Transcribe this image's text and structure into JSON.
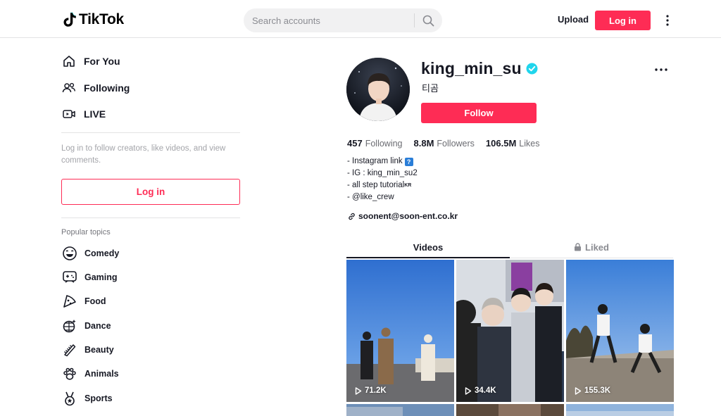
{
  "header": {
    "logo": "TikTok",
    "logo_icon": "tiktok-note-icon",
    "search_placeholder": "Search accounts",
    "upload_label": "Upload",
    "login_label": "Log in"
  },
  "sidebar": {
    "nav": [
      {
        "label": "For You",
        "icon": "home-icon"
      },
      {
        "label": "Following",
        "icon": "people-icon"
      },
      {
        "label": "LIVE",
        "icon": "live-icon"
      }
    ],
    "hint": "Log in to follow creators, like videos, and view comments.",
    "login_label": "Log in",
    "topics_title": "Popular topics",
    "topics": [
      {
        "label": "Comedy",
        "icon": "smile-icon"
      },
      {
        "label": "Gaming",
        "icon": "gamepad-icon"
      },
      {
        "label": "Food",
        "icon": "pizza-icon"
      },
      {
        "label": "Dance",
        "icon": "disco-ball-icon"
      },
      {
        "label": "Beauty",
        "icon": "comb-icon"
      },
      {
        "label": "Animals",
        "icon": "paw-icon"
      },
      {
        "label": "Sports",
        "icon": "medal-icon"
      }
    ]
  },
  "profile": {
    "username": "king_min_su",
    "verified_icon": "verified-check-icon",
    "display_name": "티곰",
    "follow_label": "Follow",
    "stats": {
      "following_count": "457",
      "following_label": "Following",
      "followers_count": "8.8M",
      "followers_label": "Followers",
      "likes_count": "106.5M",
      "likes_label": "Likes"
    },
    "bio": [
      "- Instagram link",
      "- IG : king_min_su2",
      "- all step tutorial",
      "- @like_crew"
    ],
    "bio_badge": "?",
    "bio_kr": "KR",
    "link": "soonent@soon-ent.co.kr"
  },
  "tabs": {
    "videos": "Videos",
    "liked": "Liked"
  },
  "videos": [
    {
      "views": "71.2K"
    },
    {
      "views": "34.4K"
    },
    {
      "views": "155.3K"
    }
  ],
  "colors": {
    "accent": "#fe2c55",
    "verified": "#20d5ec",
    "text": "#161823"
  }
}
